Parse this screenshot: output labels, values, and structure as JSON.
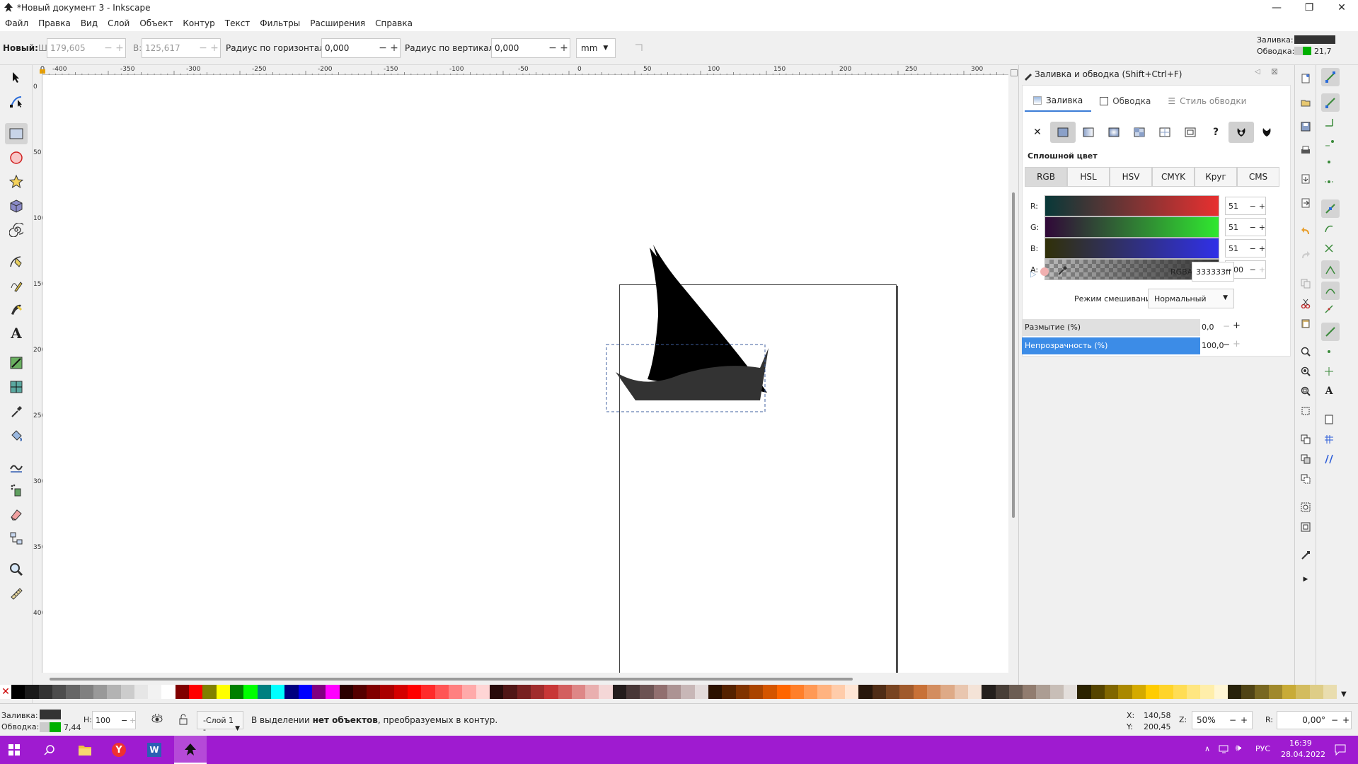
{
  "window": {
    "title": "*Новый документ 3 - Inkscape",
    "minimize": "—",
    "maximize": "❐",
    "close": "✕"
  },
  "menu": [
    "Файл",
    "Правка",
    "Вид",
    "Слой",
    "Объект",
    "Контур",
    "Текст",
    "Фильтры",
    "Расширения",
    "Справка"
  ],
  "toolctrl": {
    "new_label": "Новый:",
    "w_label": "Ш:",
    "w_value": "179,605",
    "h_label": "В:",
    "h_value": "125,617",
    "rx_label": "Радиус по горизонтали:",
    "rx_value": "0,000",
    "ry_label": "Радиус по вертикали:",
    "ry_value": "0,000",
    "unit": "mm",
    "fill_label": "Заливка:",
    "stroke_label": "Обводка:",
    "stroke_width": "21,7"
  },
  "ruler": {
    "h_ticks": [
      "-400",
      "-350",
      "-300",
      "-250",
      "-200",
      "-150",
      "-100",
      "-50",
      "0",
      "50",
      "100",
      "150",
      "200",
      "250",
      "300"
    ],
    "v_ticks": [
      "0",
      "50",
      "100",
      "150",
      "200",
      "250",
      "300",
      "350",
      "400"
    ]
  },
  "dock": {
    "title": "Заливка и обводка (Shift+Ctrl+F)",
    "tabs": [
      "Заливка",
      "Обводка",
      "Стиль обводки"
    ],
    "section": "Сплошной цвет",
    "modes": [
      "RGB",
      "HSL",
      "HSV",
      "CMYK",
      "Круг",
      "CMS"
    ],
    "r_label": "R:",
    "r_value": "51",
    "g_label": "G:",
    "g_value": "51",
    "b_label": "B:",
    "b_value": "51",
    "a_label": "A:",
    "a_value": "100",
    "rgba_label": "RGBA:",
    "rgba_value": "333333ff",
    "blend_label": "Режим смешивания:",
    "blend_value": "Нормальный",
    "blur_label": "Размытие (%)",
    "blur_value": "0,0",
    "opacity_label": "Непрозрачность (%)",
    "opacity_value": "100,0"
  },
  "status": {
    "fill_label": "Заливка:",
    "stroke_label": "Обводка:",
    "stroke_width": "7,44",
    "h_label": "Н:",
    "h_value": "100",
    "layer": "-Слой 1 -",
    "message_pre": "В выделении ",
    "message_bold": "нет объектов",
    "message_post": ", преобразуемых в контур.",
    "x_label": "X:",
    "x_value": "140,58",
    "y_label": "Y:",
    "y_value": "200,45",
    "z_label": "Z:",
    "zoom": "50%",
    "r_label": "R:",
    "rotation": "0,00°"
  },
  "taskbar": {
    "lang": "РУС",
    "time": "16:39",
    "date": "28.04.2022"
  },
  "colors": {
    "accent": "#3c7dd7",
    "taskbar": "#9f1bd0",
    "object_fill": "#333333"
  },
  "palette": [
    "#000000",
    "#1a1a1a",
    "#333333",
    "#4d4d4d",
    "#666666",
    "#808080",
    "#999999",
    "#b3b3b3",
    "#cccccc",
    "#e6e6e6",
    "#f2f2f2",
    "#ffffff",
    "#800000",
    "#ff0000",
    "#808000",
    "#ffff00",
    "#008000",
    "#00ff00",
    "#008080",
    "#00ffff",
    "#000080",
    "#0000ff",
    "#800080",
    "#ff00ff",
    "#2b0000",
    "#550000",
    "#800000",
    "#aa0000",
    "#d40000",
    "#ff0000",
    "#ff2a2a",
    "#ff5555",
    "#ff8080",
    "#ffaaaa",
    "#ffd5d5",
    "#280b0b",
    "#501616",
    "#782121",
    "#a02c2c",
    "#c83737",
    "#d35f5f",
    "#de8787",
    "#e9afaf",
    "#f4d7d7",
    "#241c1c",
    "#483737",
    "#6c5353",
    "#916f6f",
    "#ac9393",
    "#c8b7b7",
    "#e3dbdb",
    "#2b1100",
    "#552200",
    "#803300",
    "#aa4400",
    "#d45500",
    "#ff6600",
    "#ff7f2a",
    "#ff9955",
    "#ffb380",
    "#ffccaa",
    "#ffe6d5",
    "#28170b",
    "#502d16",
    "#784421",
    "#a05a2c",
    "#c87137",
    "#d38d5f",
    "#deaa87",
    "#e9c6af",
    "#f4e3d7",
    "#241f1c",
    "#483e37",
    "#6c5d53",
    "#917c6f",
    "#ac9d93",
    "#c8beb7",
    "#e3dedb",
    "#2b2200",
    "#554400",
    "#806600",
    "#aa8800",
    "#d4aa00",
    "#ffcc00",
    "#ffd42a",
    "#ffdd55",
    "#ffe680",
    "#ffeeaa",
    "#fff6d5",
    "#28220b",
    "#504416",
    "#786721",
    "#a0892c",
    "#c8ab37",
    "#d3bc5f",
    "#decd87",
    "#e9ddaf"
  ]
}
